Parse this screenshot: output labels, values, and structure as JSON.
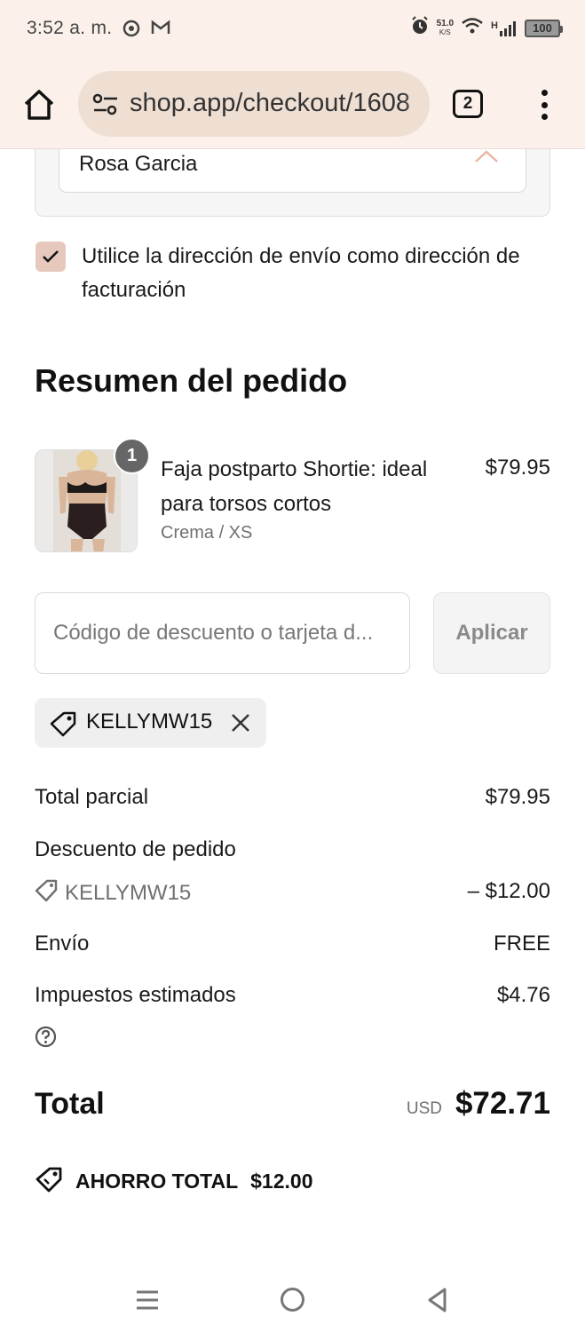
{
  "status_bar": {
    "time": "3:52 a. m.",
    "net_speed_value": "51.0",
    "net_speed_unit": "K/S",
    "network_type": "H",
    "battery": "100"
  },
  "browser": {
    "url": "shop.app/checkout/1608",
    "tab_count": "2"
  },
  "billing": {
    "name_value": "Rosa Garcia"
  },
  "shipping_as_billing": {
    "checked": true,
    "label": "Utilice la dirección de envío como dirección de facturación"
  },
  "summary": {
    "title": "Resumen del pedido",
    "product": {
      "quantity": "1",
      "name": "Faja postparto Shortie: ideal para torsos cortos",
      "variant": "Crema / XS",
      "price": "$79.95"
    },
    "discount": {
      "placeholder": "Código de descuento o tarjeta d...",
      "apply_label": "Aplicar",
      "applied_code": "KELLYMW15"
    },
    "rows": {
      "subtotal_label": "Total parcial",
      "subtotal_value": "$79.95",
      "order_discount_label": "Descuento de pedido",
      "order_discount_code": "KELLYMW15",
      "order_discount_value": "– $12.00",
      "shipping_label": "Envío",
      "shipping_value": "FREE",
      "taxes_label": "Impuestos estimados",
      "taxes_value": "$4.76"
    },
    "total": {
      "label": "Total",
      "currency": "USD",
      "value": "$72.71"
    },
    "savings": {
      "label": "AHORRO TOTAL",
      "amount": "$12.00"
    }
  },
  "icons": {
    "home": "home-icon",
    "site_settings": "tune-icon",
    "menu": "more-vert-icon",
    "tag": "tag-icon",
    "close": "close-icon",
    "help": "help-circle-icon",
    "savings": "savings-tag-icon"
  },
  "colors": {
    "browser_bg": "#fbf1ea",
    "url_pill_bg": "#efdfd3",
    "checkbox_bg": "#e7c8bd",
    "chip_bg": "#efefef"
  }
}
